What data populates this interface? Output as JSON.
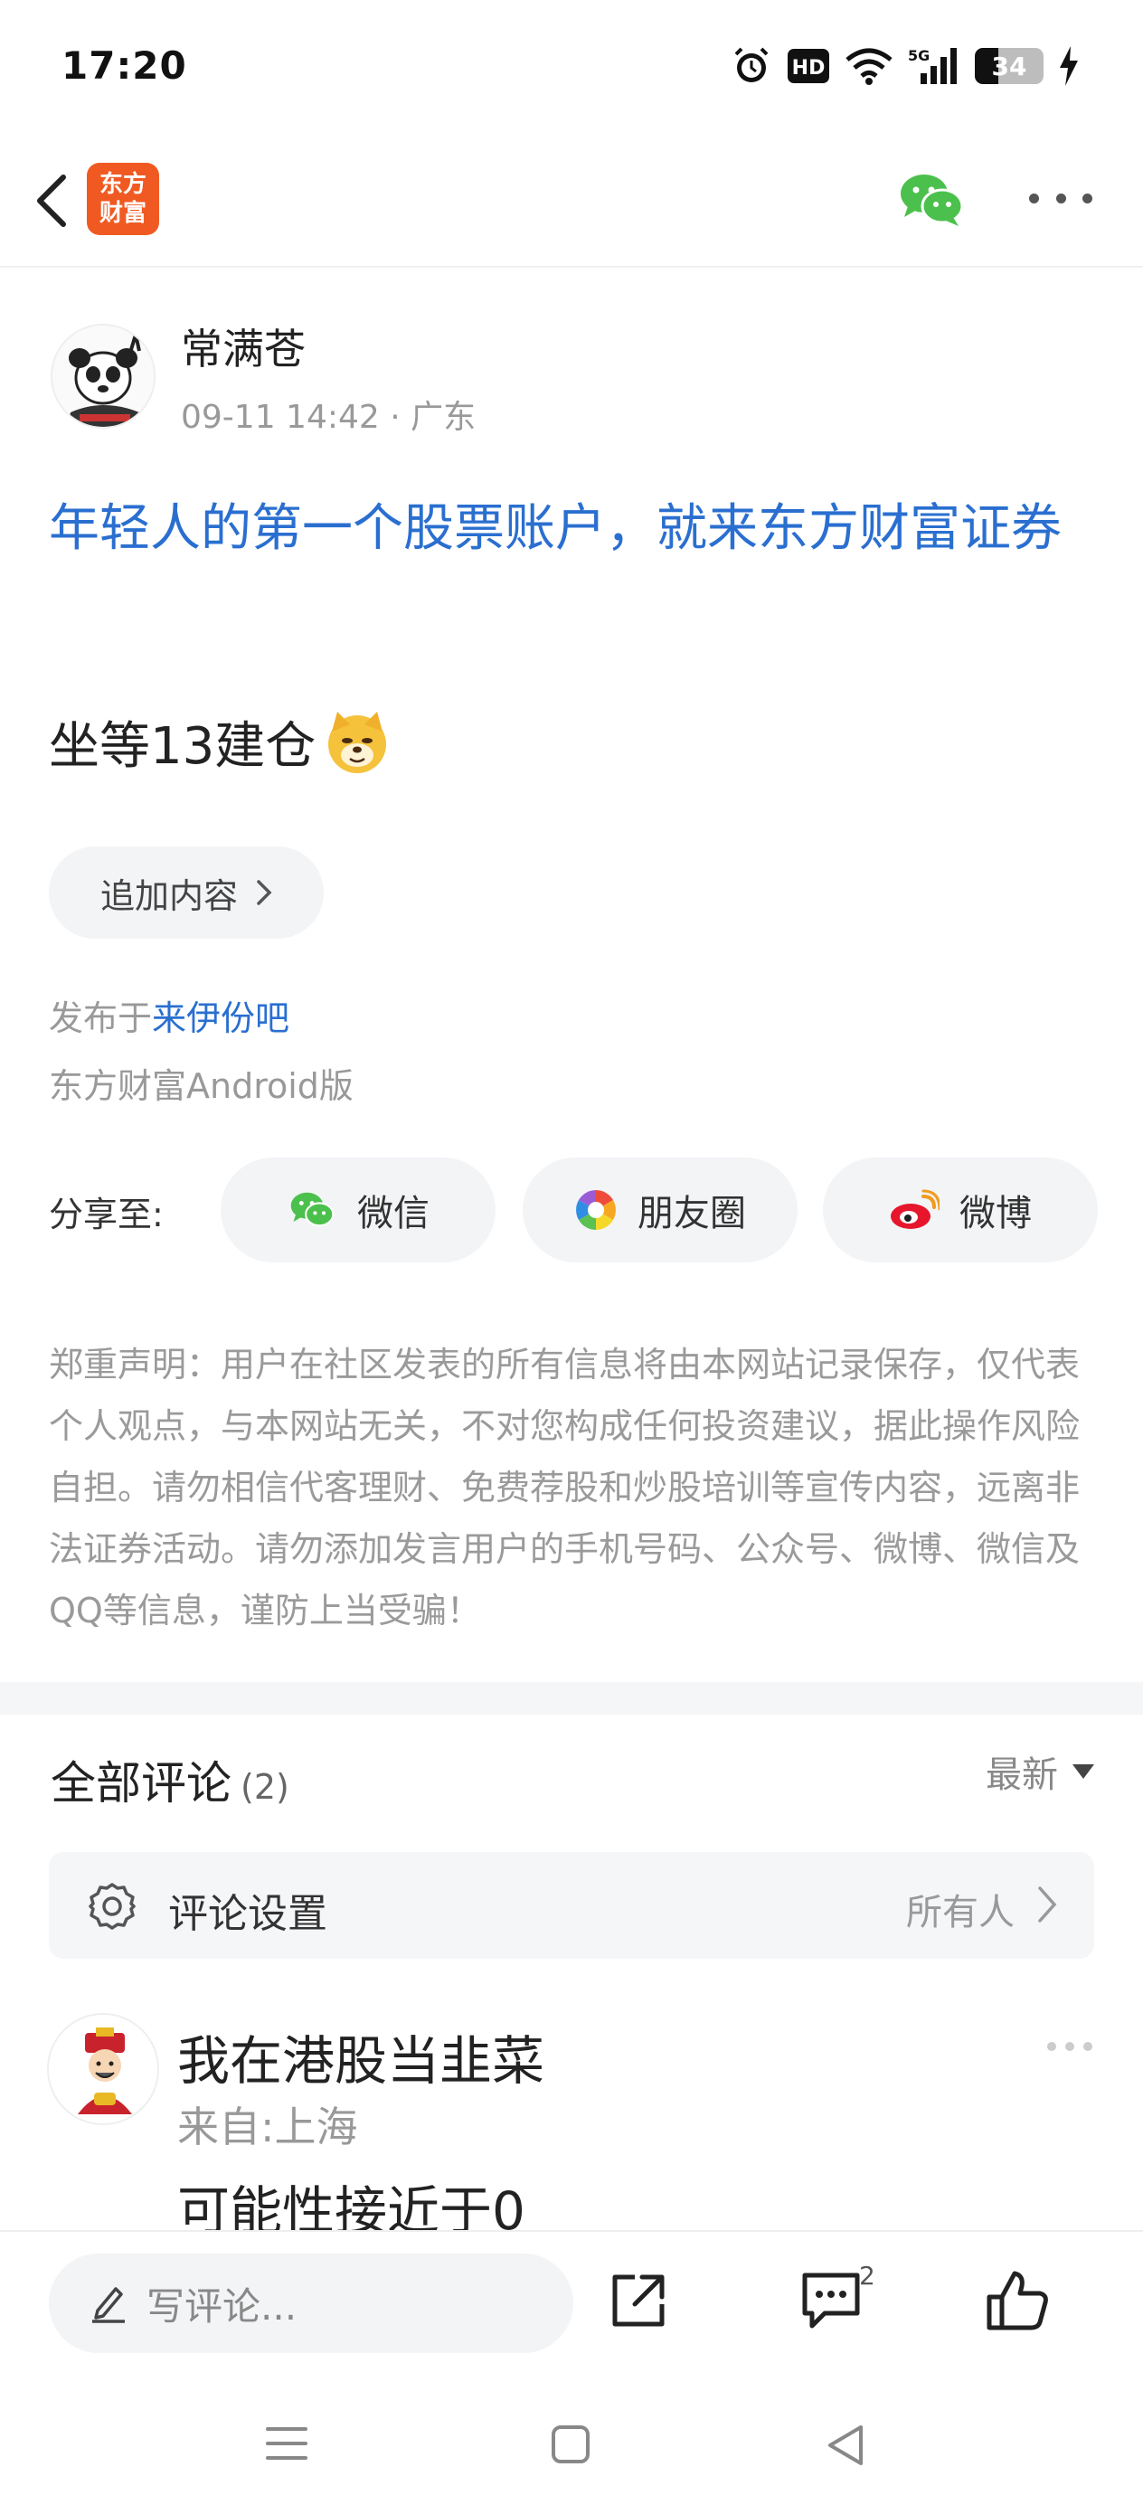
{
  "status_bar": {
    "time": "17:20",
    "battery": "34",
    "battery_level_percent": 34
  },
  "nav": {
    "logo_text_line1": "东方",
    "logo_text_line2": "财富"
  },
  "post": {
    "author": "常满苍",
    "meta": "09-11 14:42 · 广东",
    "title": "年轻人的第一个股票账户，就来东方财富证券",
    "body": "坐等13建仓",
    "append_label": "追加内容",
    "publish_prefix": "发布于",
    "publish_bar": "来伊份吧",
    "client": "东方财富Android版"
  },
  "share": {
    "label": "分享至:",
    "wechat": "微信",
    "moments": "朋友圈",
    "weibo": "微博"
  },
  "disclaimer": "郑重声明：用户在社区发表的所有信息将由本网站记录保存，仅代表个人观点，与本网站无关，不对您构成任何投资建议，据此操作风险自担。请勿相信代客理财、免费荐股和炒股培训等宣传内容，远离非法证券活动。请勿添加发言用户的手机号码、公众号、微博、微信及QQ等信息，谨防上当受骗！",
  "comments": {
    "title": "全部评论",
    "count": "(2)",
    "sort": "最新",
    "settings_label": "评论设置",
    "settings_value": "所有人",
    "items": [
      {
        "name": "我在港股当韭菜",
        "location": "来自:上海",
        "text": "可能性接近于0"
      }
    ]
  },
  "bottom_bar": {
    "write_placeholder": "写评论...",
    "comment_badge": "2"
  },
  "colors": {
    "accent_blue": "#2a6fd0",
    "brand_orange": "#f05a22",
    "wechat_green": "#4cc04c"
  }
}
